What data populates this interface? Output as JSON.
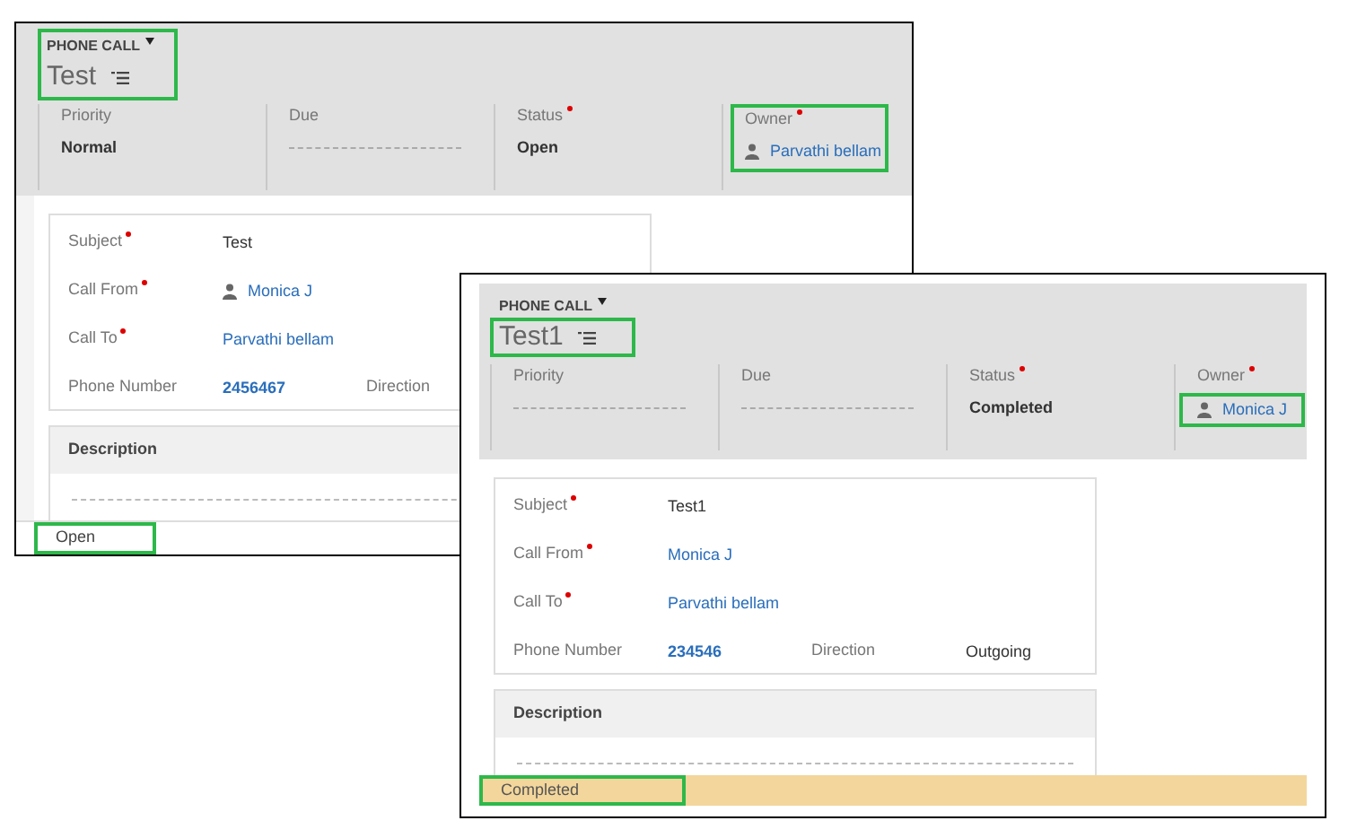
{
  "screenshots": [
    {
      "header": {
        "entity": "PHONE CALL",
        "title": "Test",
        "entity_highlighted": true,
        "title_highlighted": true
      },
      "header_fields": [
        {
          "label": "Priority",
          "required": false,
          "value": "Normal",
          "kind": "text",
          "label_highlighted": false,
          "value_highlighted": false
        },
        {
          "label": "Due",
          "required": false,
          "kind": "empty",
          "label_highlighted": false,
          "value_highlighted": false
        },
        {
          "label": "Status",
          "required": true,
          "value": "Open",
          "kind": "text",
          "label_highlighted": false,
          "value_highlighted": false
        },
        {
          "label": "Owner",
          "required": true,
          "value": "Parvathi bellam",
          "kind": "person",
          "label_highlighted": true,
          "value_highlighted": true
        }
      ],
      "form_rows": [
        {
          "cells": [
            {
              "label": "Subject",
              "required": true,
              "value": "Test",
              "kind": "text"
            }
          ]
        },
        {
          "cells": [
            {
              "label": "Call From",
              "required": true,
              "value": "Monica J",
              "kind": "person"
            }
          ]
        },
        {
          "cells": [
            {
              "label": "Call To",
              "required": true,
              "value": "Parvathi bellam",
              "kind": "link"
            }
          ]
        },
        {
          "cells": [
            {
              "label": "Phone Number",
              "required": false,
              "value": "2456467",
              "kind": "number"
            },
            {
              "label": "Direction",
              "required": false,
              "kind": "none"
            }
          ]
        }
      ],
      "description": {
        "title": "Description"
      },
      "status_bar": {
        "text": "Open",
        "kind": "open"
      }
    },
    {
      "header": {
        "entity": "PHONE CALL",
        "title": "Test1",
        "entity_highlighted": false,
        "title_highlighted": true
      },
      "header_fields": [
        {
          "label": "Priority",
          "required": false,
          "kind": "empty",
          "label_highlighted": false,
          "value_highlighted": false
        },
        {
          "label": "Due",
          "required": false,
          "kind": "empty",
          "label_highlighted": false,
          "value_highlighted": false
        },
        {
          "label": "Status",
          "required": true,
          "value": "Completed",
          "kind": "text",
          "label_highlighted": false,
          "value_highlighted": false
        },
        {
          "label": "Owner",
          "required": true,
          "value": "Monica J",
          "kind": "person",
          "label_highlighted": false,
          "value_highlighted": true
        }
      ],
      "form_rows": [
        {
          "cells": [
            {
              "label": "Subject",
              "required": true,
              "value": "Test1",
              "kind": "text"
            }
          ]
        },
        {
          "cells": [
            {
              "label": "Call From",
              "required": true,
              "value": "Monica J",
              "kind": "link"
            }
          ]
        },
        {
          "cells": [
            {
              "label": "Call To",
              "required": true,
              "value": "Parvathi bellam",
              "kind": "link"
            }
          ]
        },
        {
          "cells": [
            {
              "label": "Phone Number",
              "required": false,
              "value": "234546",
              "kind": "number"
            },
            {
              "label": "Direction",
              "required": false,
              "value": "Outgoing",
              "kind": "text"
            }
          ]
        }
      ],
      "description": {
        "title": "Description"
      },
      "status_bar": {
        "text": "Completed",
        "kind": "completed"
      }
    }
  ]
}
